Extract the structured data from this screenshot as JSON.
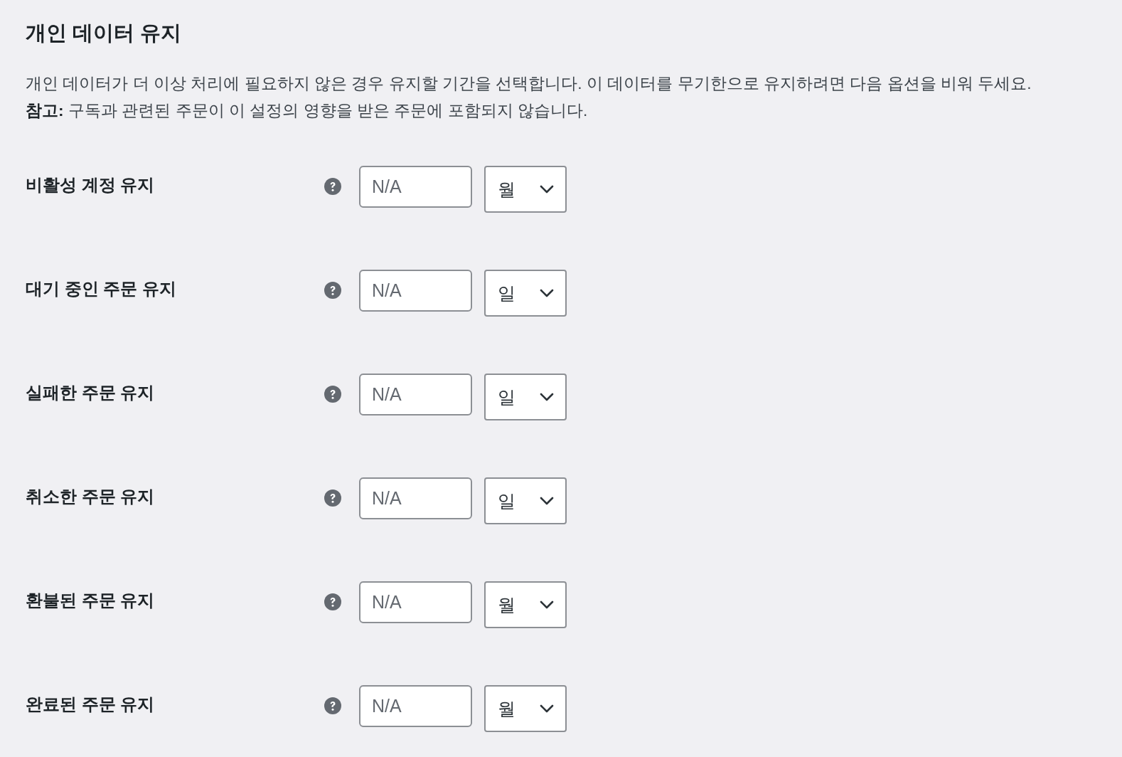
{
  "title": "개인 데이터 유지",
  "description": "개인 데이터가 더 이상 처리에 필요하지 않은 경우 유지할 기간을 선택합니다. 이 데이터를 무기한으로 유지하려면 다음 옵션을 비워 두세요.",
  "note": "**참고:** 구독과 관련된 주문이 이 설정의 영향을 받은 주문에 포함되지 않습니다.",
  "settings": [
    {
      "label": "비활성 계정 유지",
      "placeholder": "N/A",
      "unit": "월"
    },
    {
      "label": "대기 중인 주문 유지",
      "placeholder": "N/A",
      "unit": "일"
    },
    {
      "label": "실패한 주문 유지",
      "placeholder": "N/A",
      "unit": "일"
    },
    {
      "label": "취소한 주문 유지",
      "placeholder": "N/A",
      "unit": "일"
    },
    {
      "label": "환불된 주문 유지",
      "placeholder": "N/A",
      "unit": "월"
    },
    {
      "label": "완료된 주문 유지",
      "placeholder": "N/A",
      "unit": "월"
    }
  ]
}
